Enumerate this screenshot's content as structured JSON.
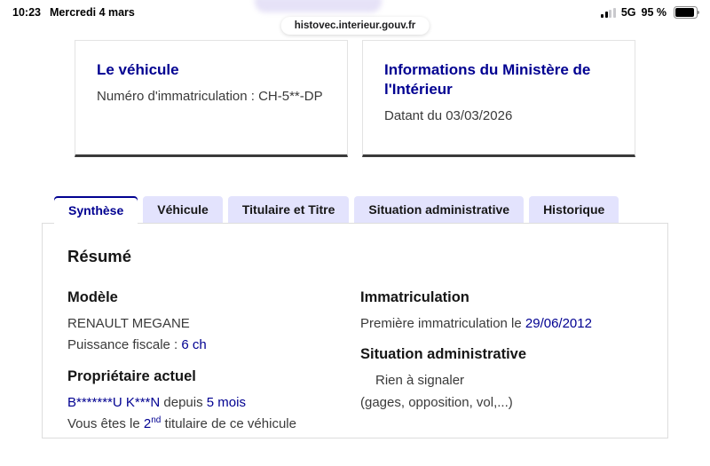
{
  "status_bar": {
    "time": "10:23",
    "date": "Mercredi 4 mars",
    "network": "5G",
    "battery_percent": "95 %",
    "signal_icon": "cellular-signal-icon",
    "battery_icon": "battery-icon"
  },
  "browser": {
    "url": "histovec.interieur.gouv.fr"
  },
  "cards": {
    "vehicle": {
      "title": "Le véhicule",
      "body_label": "Numéro d'immatriculation : ",
      "body_value": "CH-5**-DP"
    },
    "ministry": {
      "title": "Informations du Ministère de l'Intérieur",
      "body": "Datant du 03/03/2026"
    }
  },
  "tabs": [
    {
      "label": "Synthèse",
      "active": true
    },
    {
      "label": "Véhicule",
      "active": false
    },
    {
      "label": "Titulaire et Titre",
      "active": false
    },
    {
      "label": "Situation administrative",
      "active": false
    },
    {
      "label": "Historique",
      "active": false
    }
  ],
  "panel": {
    "title": "Résumé",
    "model": {
      "heading": "Modèle",
      "name": "RENAULT MEGANE",
      "power_label": "Puissance fiscale : ",
      "power_value": "6 ch"
    },
    "owner": {
      "heading": "Propriétaire actuel",
      "name": "B*******U K***N",
      "since_label": " depuis ",
      "since_value": "5 mois",
      "holder_prefix": "Vous êtes le ",
      "holder_number": "2",
      "holder_ordinal": "nd",
      "holder_suffix": " titulaire de ce véhicule"
    },
    "registration": {
      "heading": "Immatriculation",
      "label": "Première immatriculation le ",
      "date": "29/06/2012"
    },
    "situation": {
      "heading": "Situation administrative",
      "status": "Rien à signaler",
      "note": "(gages, opposition, vol,...)"
    }
  },
  "colors": {
    "accent_blue": "#000091",
    "tab_inactive_bg": "#e3e3fd",
    "card_bottom_border": "#3a3a3a",
    "body_text": "#3a3a3a",
    "heading_text": "#161616"
  }
}
